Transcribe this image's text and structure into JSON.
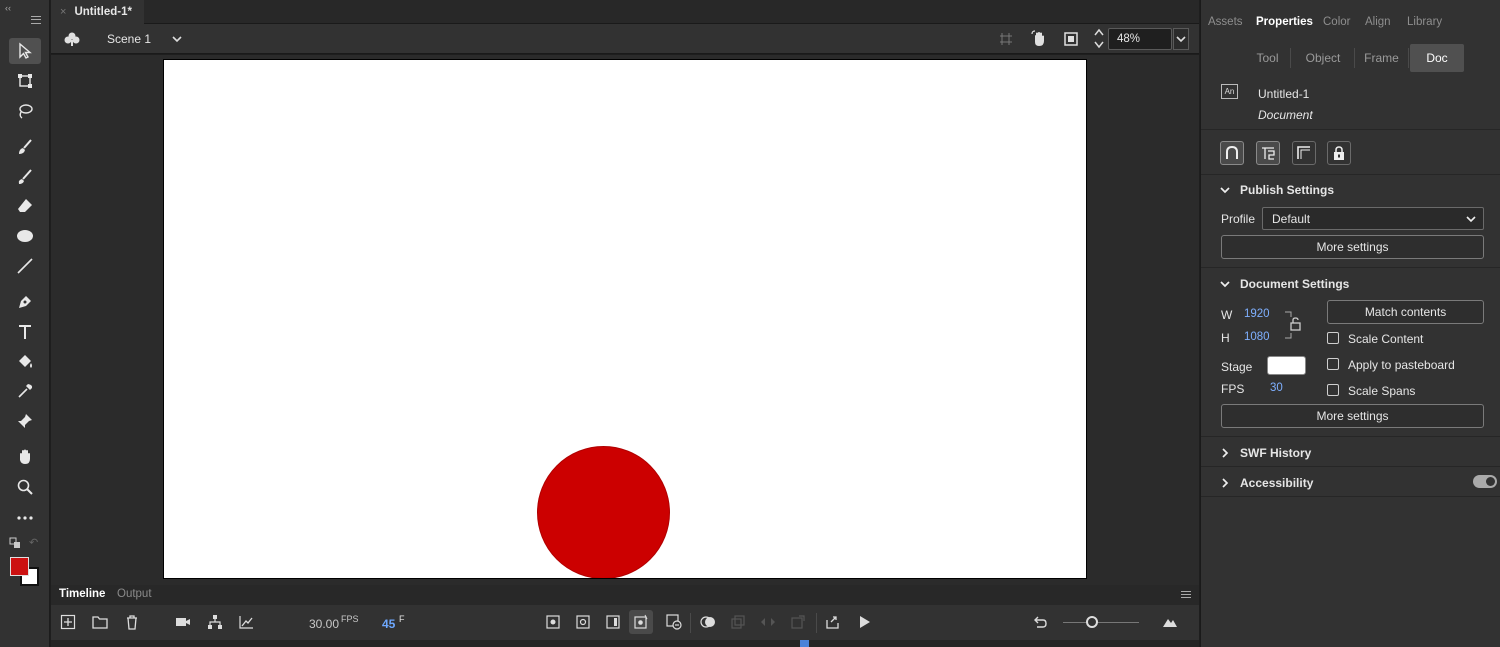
{
  "document_tab": {
    "close_glyph": "×",
    "title": "Untitled-1*"
  },
  "scene": {
    "name": "Scene 1"
  },
  "zoom": {
    "value": "48%"
  },
  "timeline": {
    "tabs": [
      "Timeline",
      "Output"
    ],
    "fps_value": "30.00",
    "fps_label": "FPS",
    "frame_value": "45",
    "frame_label": "F"
  },
  "right_panel": {
    "tabs": [
      "Assets",
      "Properties",
      "Color",
      "Align",
      "Library"
    ],
    "active_tab": "Properties",
    "sub_tabs": [
      "Tool",
      "Object",
      "Frame",
      "Doc"
    ],
    "active_sub_tab": "Doc",
    "doc_icon_text": "An",
    "doc_name": "Untitled-1",
    "doc_type": "Document",
    "publish": {
      "title": "Publish Settings",
      "profile_label": "Profile",
      "profile_value": "Default",
      "more_settings": "More settings"
    },
    "document_settings": {
      "title": "Document Settings",
      "w_label": "W",
      "w_value": "1920",
      "h_label": "H",
      "h_value": "1080",
      "match_contents": "Match contents",
      "scale_content": "Scale Content",
      "apply_pasteboard": "Apply to pasteboard",
      "scale_spans": "Scale Spans",
      "stage_label": "Stage",
      "stage_color": "#ffffff",
      "fps_label": "FPS",
      "fps_value": "30",
      "more_settings": "More settings"
    },
    "swf_history": "SWF History",
    "accessibility": "Accessibility"
  },
  "colors": {
    "fill": "#cc1111",
    "stroke": "#ffffff",
    "ball": "#cc0000",
    "accent": "#4c83d9"
  }
}
